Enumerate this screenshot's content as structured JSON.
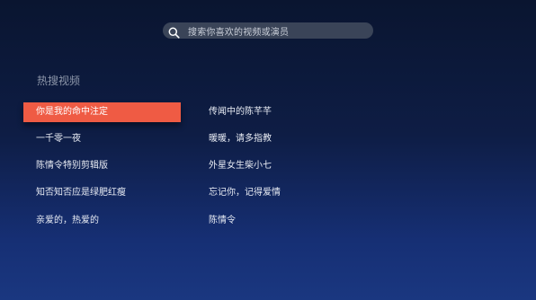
{
  "search": {
    "icon": "search-icon",
    "placeholder": "搜索你喜欢的视频或演员"
  },
  "hot_search": {
    "title": "热搜视频",
    "left_column": [
      {
        "label": "你是我的命中注定",
        "selected": true
      },
      {
        "label": "一千零一夜",
        "selected": false
      },
      {
        "label": "陈情令特别剪辑版",
        "selected": false
      },
      {
        "label": "知否知否应是绿肥红瘦",
        "selected": false
      },
      {
        "label": "亲爱的，热爱的",
        "selected": false
      }
    ],
    "right_column": [
      {
        "label": "传闻中的陈芊芊",
        "selected": false
      },
      {
        "label": "暖暖，请多指教",
        "selected": false
      },
      {
        "label": "外星女生柴小七",
        "selected": false
      },
      {
        "label": "忘记你，记得爱情",
        "selected": false
      },
      {
        "label": "陈情令",
        "selected": false
      }
    ]
  },
  "colors": {
    "accent": "#ef5b44",
    "background_top": "#0a1530",
    "background_bottom": "#1a3780"
  }
}
